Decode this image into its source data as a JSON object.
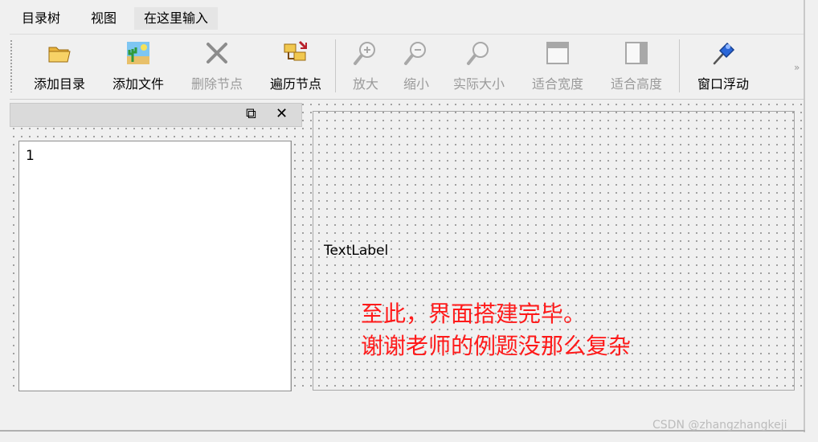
{
  "menubar": {
    "items": [
      {
        "label": "目录树"
      },
      {
        "label": "视图"
      },
      {
        "label": "在这里输入"
      }
    ]
  },
  "toolbar": {
    "buttons": [
      {
        "label": "添加目录",
        "icon": "folder-open-icon",
        "enabled": true
      },
      {
        "label": "添加文件",
        "icon": "image-file-icon",
        "enabled": true
      },
      {
        "label": "删除节点",
        "icon": "delete-x-icon",
        "enabled": false
      },
      {
        "label": "遍历节点",
        "icon": "traverse-folders-icon",
        "enabled": true
      },
      {
        "label": "放大",
        "icon": "zoom-in-icon",
        "enabled": false
      },
      {
        "label": "缩小",
        "icon": "zoom-out-icon",
        "enabled": false
      },
      {
        "label": "实际大小",
        "icon": "zoom-actual-icon",
        "enabled": false
      },
      {
        "label": "适合宽度",
        "icon": "fit-width-icon",
        "enabled": false
      },
      {
        "label": "适合高度",
        "icon": "fit-height-icon",
        "enabled": false
      },
      {
        "label": "窗口浮动",
        "icon": "pushpin-icon",
        "enabled": true
      }
    ],
    "more": "»"
  },
  "dock": {
    "float_glyph": "⧉",
    "close_glyph": "✕",
    "tree_items": [
      "1"
    ]
  },
  "content": {
    "text_label": "TextLabel",
    "annotation_line1": "至此，界面搭建完毕。",
    "annotation_line2": "谢谢老师的例题没那么复杂"
  },
  "watermark": "CSDN @zhangzhangkeji",
  "colors": {
    "annotation": "#ff1a1a",
    "background": "#f0f0f0"
  }
}
